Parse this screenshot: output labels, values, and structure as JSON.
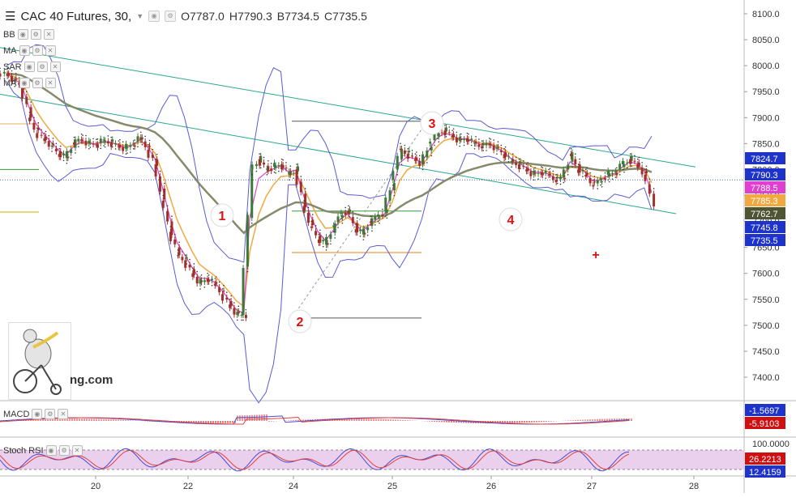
{
  "header": {
    "symbol": "CAC 40 Futures, 30,",
    "dropdown_icon": "chevron-down-icon",
    "open": "O7787.0",
    "high": "H7790.3",
    "low": "B7734.5",
    "close": "C7735.5"
  },
  "indicators": [
    {
      "label": "BB"
    },
    {
      "label": "MA"
    },
    {
      "label": "SAR"
    },
    {
      "label": "MA"
    }
  ],
  "logo_text": "ng.com",
  "colors": {
    "up": "#3d7a3a",
    "down": "#a0302a",
    "bb": "#5b5bd6",
    "ma_fast": "#f0a840",
    "ma_magenta": "#e040d0",
    "ma_slow": "#858a6a",
    "channel": "#2aa68c",
    "annotation": "#dd1111",
    "macd_line": "#4a4ad0",
    "signal_line": "#e04040",
    "rsi_k": "#4a4ad0",
    "rsi_d": "#e04040",
    "rsi_band": "#e6c4e8"
  },
  "chart_data": {
    "type": "candlestick",
    "symbol": "CAC 40 Futures",
    "timeframe": "30",
    "y_ticks": [
      "8100.0",
      "8050.0",
      "8000.0",
      "7950.0",
      "7900.0",
      "7850.0",
      "7800.0",
      "7750.0",
      "7700.0",
      "7650.0",
      "7600.0",
      "7550.0",
      "7500.0",
      "7450.0",
      "7400.0"
    ],
    "x_ticks": [
      "20",
      "22",
      "24",
      "25",
      "26",
      "27",
      "28"
    ],
    "ylim": [
      7360,
      8115
    ],
    "price_labels": [
      {
        "value": "7824.7",
        "color": "#1d33c9"
      },
      {
        "value": "7790.3",
        "color": "#1d33c9"
      },
      {
        "value": "7788.5",
        "color": "#e040d0"
      },
      {
        "value": "7785.3",
        "color": "#f0a840"
      },
      {
        "value": "7762.7",
        "color": "#4f5534"
      },
      {
        "value": "7745.8",
        "color": "#1d33c9"
      },
      {
        "value": "7735.5",
        "color": "#1d33c9"
      }
    ],
    "close_path": [
      [
        0,
        7985
      ],
      [
        0.25,
        7970
      ],
      [
        0.5,
        7960
      ],
      [
        0.75,
        7900
      ],
      [
        1.0,
        7870
      ],
      [
        1.25,
        7860
      ],
      [
        1.5,
        7845
      ],
      [
        1.75,
        7830
      ],
      [
        2.0,
        7822
      ],
      [
        2.25,
        7852
      ],
      [
        2.5,
        7858
      ],
      [
        2.75,
        7850
      ],
      [
        3.0,
        7848
      ],
      [
        3.25,
        7856
      ],
      [
        3.5,
        7852
      ],
      [
        3.75,
        7845
      ],
      [
        4.0,
        7840
      ],
      [
        4.25,
        7850
      ],
      [
        4.5,
        7862
      ],
      [
        4.75,
        7838
      ],
      [
        5.0,
        7810
      ],
      [
        5.25,
        7740
      ],
      [
        5.5,
        7680
      ],
      [
        5.75,
        7635
      ],
      [
        6.0,
        7625
      ],
      [
        6.25,
        7600
      ],
      [
        6.5,
        7580
      ],
      [
        6.75,
        7590
      ],
      [
        7.0,
        7580
      ],
      [
        7.25,
        7560
      ],
      [
        7.5,
        7540
      ],
      [
        7.75,
        7520
      ],
      [
        8.0,
        7520
      ],
      [
        8.2,
        7800
      ],
      [
        8.5,
        7820
      ],
      [
        8.75,
        7800
      ],
      [
        9.0,
        7805
      ],
      [
        9.25,
        7810
      ],
      [
        9.5,
        7790
      ],
      [
        9.75,
        7800
      ],
      [
        10.0,
        7730
      ],
      [
        10.25,
        7690
      ],
      [
        10.5,
        7665
      ],
      [
        10.75,
        7655
      ],
      [
        11.0,
        7690
      ],
      [
        11.25,
        7715
      ],
      [
        11.5,
        7720
      ],
      [
        11.75,
        7685
      ],
      [
        12.0,
        7675
      ],
      [
        12.25,
        7700
      ],
      [
        12.5,
        7710
      ],
      [
        12.75,
        7720
      ],
      [
        13.0,
        7780
      ],
      [
        13.25,
        7840
      ],
      [
        13.5,
        7830
      ],
      [
        13.75,
        7820
      ],
      [
        14.0,
        7810
      ],
      [
        14.25,
        7850
      ],
      [
        14.5,
        7870
      ],
      [
        14.75,
        7875
      ],
      [
        15.0,
        7865
      ],
      [
        15.25,
        7855
      ],
      [
        15.5,
        7860
      ],
      [
        15.75,
        7850
      ],
      [
        16.0,
        7845
      ],
      [
        16.25,
        7850
      ],
      [
        16.5,
        7840
      ],
      [
        16.75,
        7830
      ],
      [
        17.0,
        7815
      ],
      [
        17.25,
        7810
      ],
      [
        17.5,
        7800
      ],
      [
        17.75,
        7790
      ],
      [
        18.0,
        7795
      ],
      [
        18.25,
        7790
      ],
      [
        18.5,
        7780
      ],
      [
        18.75,
        7785
      ],
      [
        19.0,
        7830
      ],
      [
        19.25,
        7800
      ],
      [
        19.5,
        7790
      ],
      [
        19.75,
        7770
      ],
      [
        20.0,
        7780
      ],
      [
        20.25,
        7790
      ],
      [
        20.5,
        7795
      ],
      [
        20.75,
        7810
      ],
      [
        21.0,
        7820
      ],
      [
        21.25,
        7810
      ],
      [
        21.5,
        7790
      ],
      [
        21.75,
        7735
      ]
    ],
    "annotations": [
      "1",
      "2",
      "3",
      "4",
      "+"
    ],
    "subpanes": [
      {
        "name": "MACD",
        "values": [
          "-1.5697",
          "-5.9103"
        ]
      },
      {
        "name": "Stoch RSI",
        "ticks": [
          "100.0000"
        ],
        "values": [
          "26.2213",
          "12.4159"
        ]
      }
    ]
  }
}
